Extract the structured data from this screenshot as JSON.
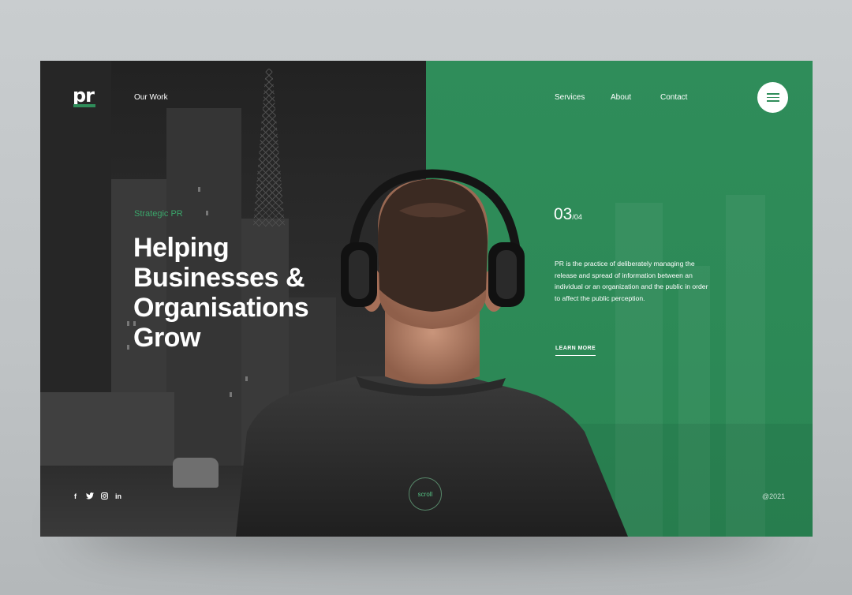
{
  "brand": {
    "logo_text": "pr",
    "accent": "#2f8d5a",
    "dark": "#2a2a2a"
  },
  "nav": {
    "left_link": "Our Work",
    "right_links": [
      "Services",
      "About",
      "Contact"
    ],
    "menu_icon": "hamburger-icon"
  },
  "hero": {
    "eyebrow": "Strategic PR",
    "headline_lines": [
      "Helping",
      "Businesses &",
      "Organisations",
      "Grow"
    ]
  },
  "slide": {
    "current": "03",
    "total": "/04"
  },
  "description": "PR is the practice of deliberately managing the release and spread of information between an individual or an organization and the public in order to affect the public perception.",
  "cta": {
    "label": "LEARN MORE"
  },
  "footer": {
    "social": [
      {
        "icon": "facebook-icon",
        "glyph": "f"
      },
      {
        "icon": "twitter-icon",
        "glyph": "t"
      },
      {
        "icon": "instagram-icon",
        "glyph": "ig"
      },
      {
        "icon": "linkedin-icon",
        "glyph": "in"
      }
    ],
    "scroll_label": "scroll",
    "copyright": "@2021"
  }
}
